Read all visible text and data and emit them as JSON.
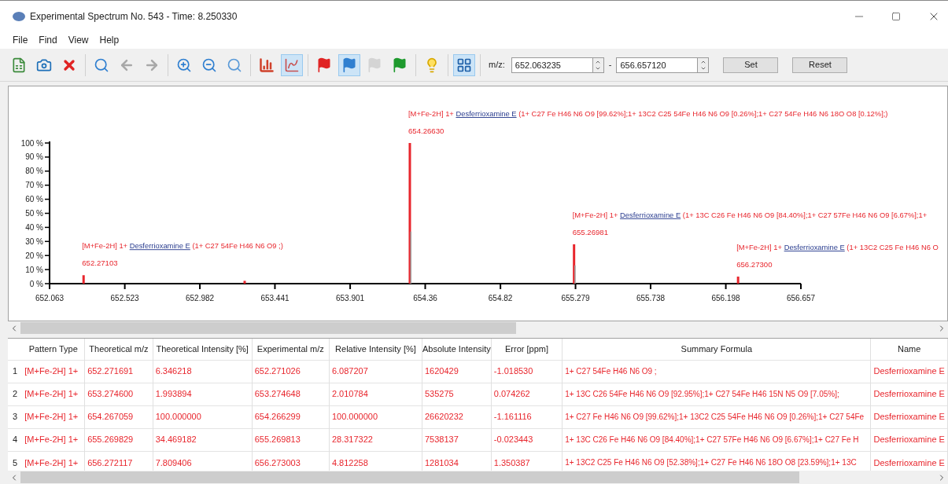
{
  "window": {
    "title": "Experimental Spectrum No. 543 - Time: 8.250330"
  },
  "menu": [
    "File",
    "Find",
    "View",
    "Help"
  ],
  "toolbar_groups": [
    [
      {
        "kind": "csv",
        "selected": false
      },
      {
        "kind": "camera",
        "selected": false
      },
      {
        "kind": "delete",
        "selected": false
      }
    ],
    [
      {
        "kind": "search",
        "selected": false
      },
      {
        "kind": "back",
        "selected": false
      },
      {
        "kind": "forward",
        "selected": false
      }
    ],
    [
      {
        "kind": "zoom-in",
        "selected": false
      },
      {
        "kind": "zoom-out",
        "selected": false
      },
      {
        "kind": "zoom-auto",
        "selected": false
      }
    ],
    [
      {
        "kind": "bar-chart",
        "selected": false
      },
      {
        "kind": "spectrum",
        "selected": true
      }
    ],
    [
      {
        "kind": "flag",
        "color": "#e02424",
        "selected": false
      },
      {
        "kind": "flag",
        "color": "#2f7fd0",
        "selected": true
      },
      {
        "kind": "flag",
        "color": "#d4d4d4",
        "selected": false
      },
      {
        "kind": "flag",
        "color": "#1e9a2e",
        "selected": false
      }
    ],
    [
      {
        "kind": "bulb",
        "selected": false
      }
    ],
    [
      {
        "kind": "grid",
        "selected": true
      }
    ]
  ],
  "range": {
    "label": "m/z:",
    "from": "652.063235",
    "separator": "-",
    "to": "656.657120",
    "buttons": [
      "Set",
      "Reset"
    ]
  },
  "spectrum": {
    "chart_data": {
      "type": "bar",
      "x": [
        652.271,
        653.256,
        654.266,
        655.27,
        656.273
      ],
      "series": [
        {
          "color": "#e8262d",
          "values": [
            6,
            2,
            100,
            28,
            5
          ]
        },
        {
          "color": "#a0a0a0",
          "values": [
            null,
            null,
            37,
            13,
            null
          ]
        }
      ],
      "xlim": [
        652.063,
        656.657
      ],
      "ylim": [
        0,
        100
      ],
      "xticks": [
        {
          "value": 652.063,
          "label": "652.063"
        },
        {
          "value": 652.523,
          "label": "652.523"
        },
        {
          "value": 652.982,
          "label": "652.982"
        },
        {
          "value": 653.441,
          "label": "653.441"
        },
        {
          "value": 653.901,
          "label": "653.901"
        },
        {
          "value": 654.36,
          "label": "654.36"
        },
        {
          "value": 654.82,
          "label": "654.82"
        },
        {
          "value": 655.279,
          "label": "655.279"
        },
        {
          "value": 655.738,
          "label": "655.738"
        },
        {
          "value": 656.198,
          "label": "656.198"
        },
        {
          "value": 656.657,
          "label": "656.657"
        }
      ],
      "yticks": [
        {
          "value": 0,
          "label": "0 %"
        },
        {
          "value": 10,
          "label": "10 %"
        },
        {
          "value": 20,
          "label": "20 %"
        },
        {
          "value": 30,
          "label": "30 %"
        },
        {
          "value": 40,
          "label": "40 %"
        },
        {
          "value": 50,
          "label": "50 %"
        },
        {
          "value": 60,
          "label": "60 %"
        },
        {
          "value": 70,
          "label": "70 %"
        },
        {
          "value": 80,
          "label": "80 %"
        },
        {
          "value": 90,
          "label": "90 %"
        },
        {
          "value": 100,
          "label": "100 %"
        }
      ],
      "stacked": false
    },
    "peak_labels": [
      {
        "prefix": "[M+Fe-2H] 1+",
        "link": "Desferrioxamine E",
        "formula": "(1+ C27 54Fe H46 N6 O9 ;)",
        "mz": "652.27103"
      },
      {
        "prefix": "[M+Fe-2H] 1+",
        "link": "Desferrioxamine E",
        "formula": "(1+ C27 Fe H46 N6 O9 [99.62%];1+ 13C2 C25 54Fe H46 N6 O9 [0.26%];1+ C27 54Fe H46 N6 18O O8 [0.12%];)",
        "mz": "654.26630"
      },
      {
        "prefix": "[M+Fe-2H] 1+",
        "link": "Desferrioxamine E",
        "formula": "(1+ 13C C26 Fe H46 N6 O9 [84.40%];1+ C27 57Fe H46 N6 O9 [6.67%];1+",
        "mz": "655.26981"
      },
      {
        "prefix": "[M+Fe-2H] 1+",
        "link": "Desferrioxamine E",
        "formula": "(1+ 13C2 C25 Fe H46 N6 O",
        "mz": "656.27300"
      }
    ]
  },
  "table": {
    "columns": [
      "Pattern Type",
      "Theoretical m/z",
      "Theoretical Intensity [%]",
      "Experimental m/z",
      "Relative Intensity [%]",
      "Absolute Intensity",
      "Error [ppm]",
      "Summary Formula",
      "Name"
    ],
    "rows": [
      {
        "index": "1",
        "cells": [
          "[M+Fe-2H] 1+",
          "652.271691",
          "6.346218",
          "652.271026",
          "6.087207",
          "1620429",
          "-1.018530",
          "1+ C27 54Fe H46 N6 O9 ;",
          "Desferrioxamine E"
        ]
      },
      {
        "index": "2",
        "cells": [
          "[M+Fe-2H] 1+",
          "653.274600",
          "1.993894",
          "653.274648",
          "2.010784",
          "535275",
          "0.074262",
          "1+ 13C C26 54Fe H46 N6 O9 [92.95%];1+ C27 54Fe H46 15N N5 O9 [7.05%];",
          "Desferrioxamine E"
        ]
      },
      {
        "index": "3",
        "cells": [
          "[M+Fe-2H] 1+",
          "654.267059",
          "100.000000",
          "654.266299",
          "100.000000",
          "26620232",
          "-1.161116",
          "1+ C27 Fe H46 N6 O9 [99.62%];1+ 13C2 C25 54Fe H46 N6 O9 [0.26%];1+ C27 54Fe",
          "Desferrioxamine E"
        ]
      },
      {
        "index": "4",
        "cells": [
          "[M+Fe-2H] 1+",
          "655.269829",
          "34.469182",
          "655.269813",
          "28.317322",
          "7538137",
          "-0.023443",
          "1+ 13C C26 Fe H46 N6 O9 [84.40%];1+ C27 57Fe H46 N6 O9 [6.67%];1+ C27 Fe H",
          "Desferrioxamine E"
        ]
      },
      {
        "index": "5",
        "cells": [
          "[M+Fe-2H] 1+",
          "656.272117",
          "7.809406",
          "656.273003",
          "4.812258",
          "1281034",
          "1.350387",
          "1+ 13C2 C25 Fe H46 N6 O9 [52.38%];1+ C27 Fe H46 N6 18O O8 [23.59%];1+ 13C",
          "Desferrioxamine E"
        ]
      }
    ]
  }
}
